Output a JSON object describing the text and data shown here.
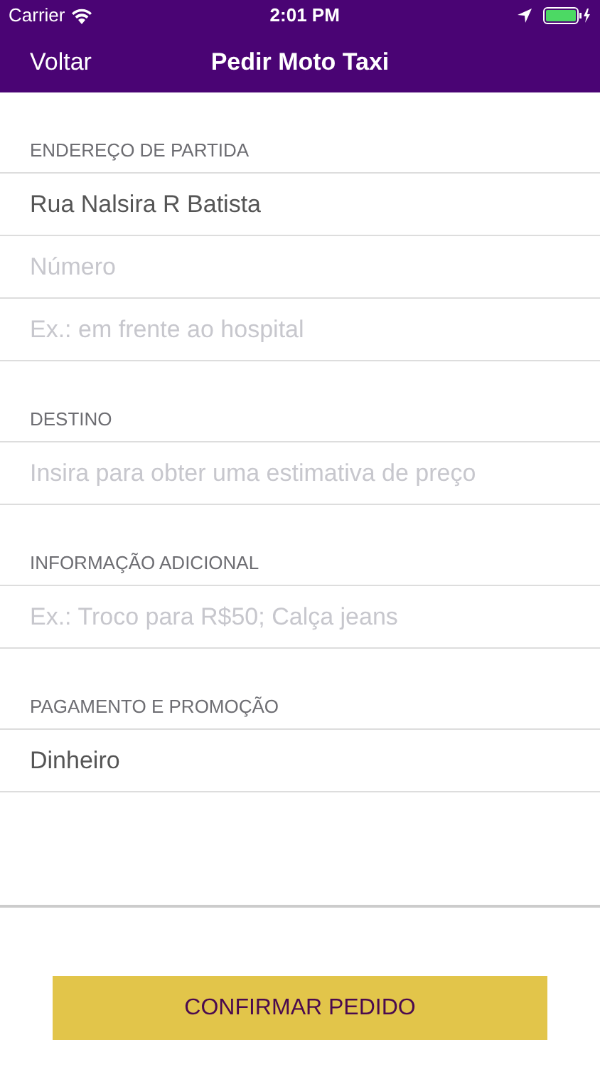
{
  "status_bar": {
    "carrier": "Carrier",
    "time": "2:01 PM"
  },
  "nav": {
    "back": "Voltar",
    "title": "Pedir Moto Taxi"
  },
  "sections": [
    {
      "header": "ENDEREÇO DE PARTIDA",
      "fields": [
        {
          "value": "Rua Nalsira R Batista"
        },
        {
          "placeholder": "Número"
        },
        {
          "placeholder": "Ex.: em frente ao hospital"
        }
      ]
    },
    {
      "header": "DESTINO",
      "fields": [
        {
          "placeholder": "Insira para obter uma estimativa de preço"
        }
      ]
    },
    {
      "header": "INFORMAÇÃO ADICIONAL",
      "fields": [
        {
          "placeholder": "Ex.: Troco para R$50; Calça jeans"
        }
      ]
    },
    {
      "header": "PAGAMENTO E PROMOÇÃO",
      "fields": [
        {
          "value": "Dinheiro"
        }
      ]
    }
  ],
  "confirm_button": "CONFIRMAR PEDIDO"
}
